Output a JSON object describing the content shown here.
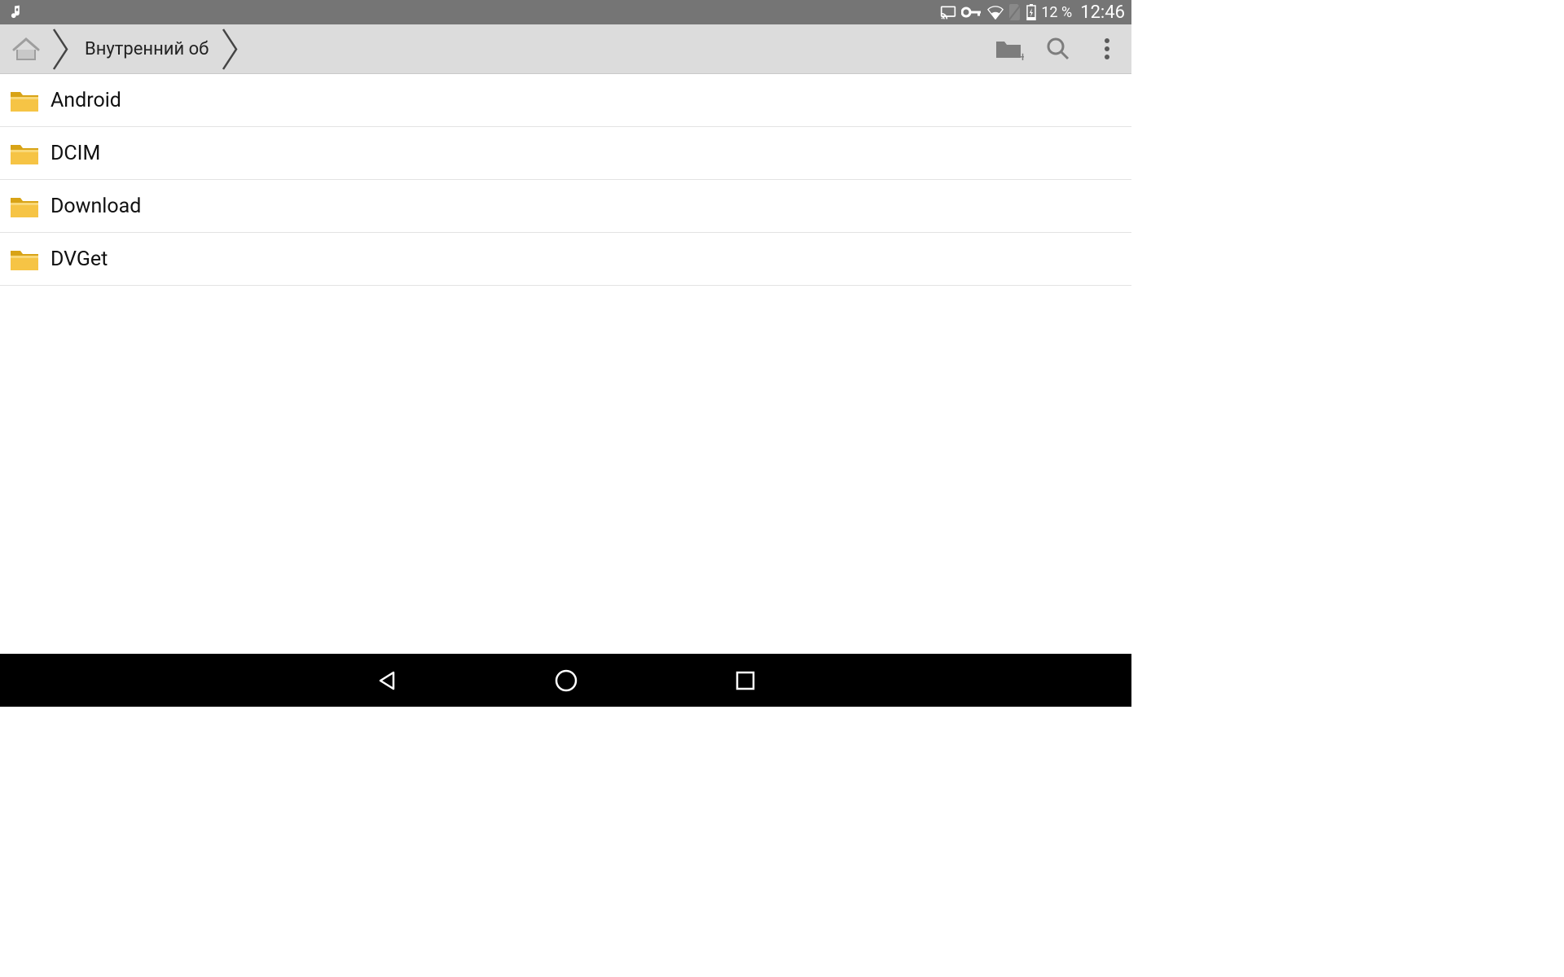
{
  "status": {
    "battery_text": "12 %",
    "clock": "12:46"
  },
  "appbar": {
    "breadcrumb": {
      "current": "Внутренний об"
    }
  },
  "folders": [
    {
      "name": "Android"
    },
    {
      "name": "DCIM"
    },
    {
      "name": "Download"
    },
    {
      "name": "DVGet"
    }
  ]
}
